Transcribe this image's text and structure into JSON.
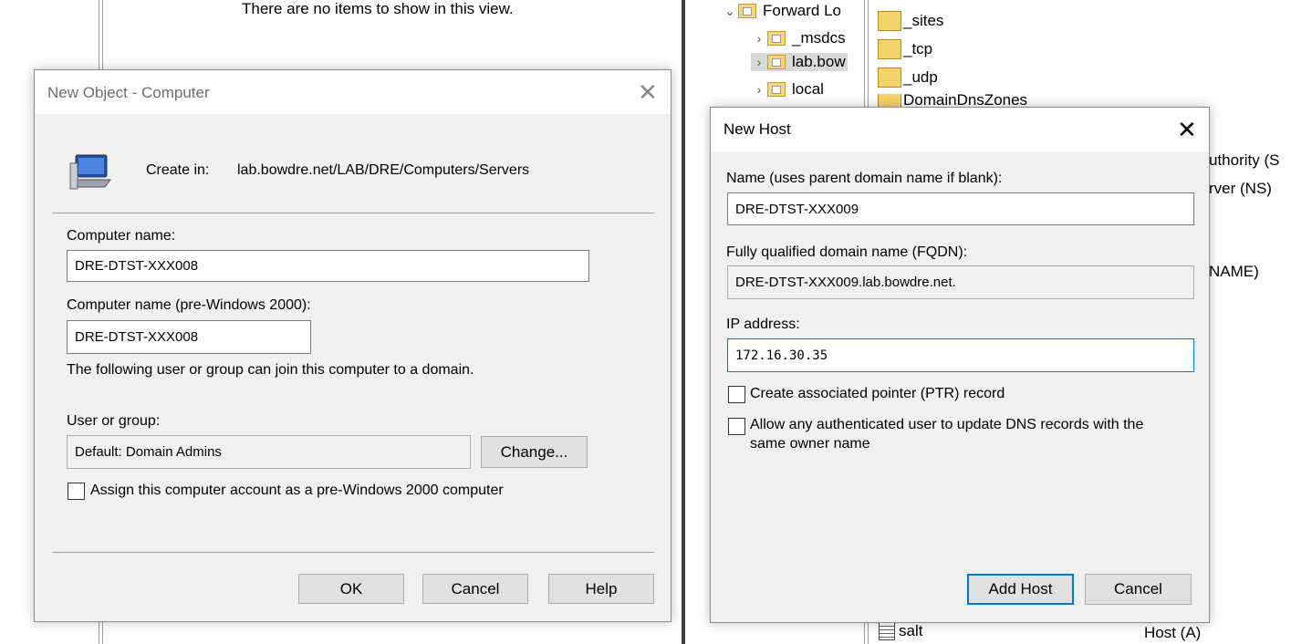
{
  "left_pane": {
    "empty_message": "There are no items to show in this view."
  },
  "right_pane": {
    "tree": [
      {
        "label": "Forward Lo",
        "chevron": "expanded"
      },
      {
        "label": "_msdcs",
        "chevron": "collapsed"
      },
      {
        "label": "lab.bow",
        "chevron": "collapsed"
      },
      {
        "label": "local",
        "chevron": "collapsed"
      }
    ],
    "zone_items": [
      "_sites",
      "_tcp",
      "_udp",
      "DomainDnsZones"
    ],
    "partial_types": [
      "uthority (S",
      "rver (NS)",
      "NAME)"
    ],
    "bottom_record": {
      "name": "salt",
      "type": "Host (A)"
    }
  },
  "new_object_dialog": {
    "title": "New Object - Computer",
    "create_in_label": "Create in:",
    "create_in_path": "lab.bowdre.net/LAB/DRE/Computers/Servers",
    "computer_name_label": "Computer name:",
    "computer_name_value": "DRE-DTST-XXX008",
    "pre2000_label": "Computer name (pre-Windows 2000):",
    "pre2000_value": "DRE-DTST-XXX008",
    "join_text": "The following user or group can join this computer to a domain.",
    "user_group_label": "User or group:",
    "user_group_value": "Default: Domain Admins",
    "change_button": "Change...",
    "assign_checkbox_label": "Assign this computer account as a pre-Windows 2000 computer",
    "ok_button": "OK",
    "cancel_button": "Cancel",
    "help_button": "Help"
  },
  "new_host_dialog": {
    "title": "New Host",
    "name_label": "Name (uses parent domain name if blank):",
    "name_value": "DRE-DTST-XXX009",
    "fqdn_label": "Fully qualified domain name (FQDN):",
    "fqdn_value": "DRE-DTST-XXX009.lab.bowdre.net.",
    "ip_label": "IP address:",
    "ip_value": "172.16.30.35",
    "ptr_checkbox_label": "Create associated pointer (PTR) record",
    "allow_checkbox_label_line1": "Allow any authenticated user to update DNS records with the",
    "allow_checkbox_label_line2": "same owner name",
    "add_host_button": "Add Host",
    "cancel_button": "Cancel"
  },
  "colors": {
    "dialog_bg": "#f0f0f0",
    "focus_border": "#0078d7",
    "folder": "#f5d36b"
  }
}
